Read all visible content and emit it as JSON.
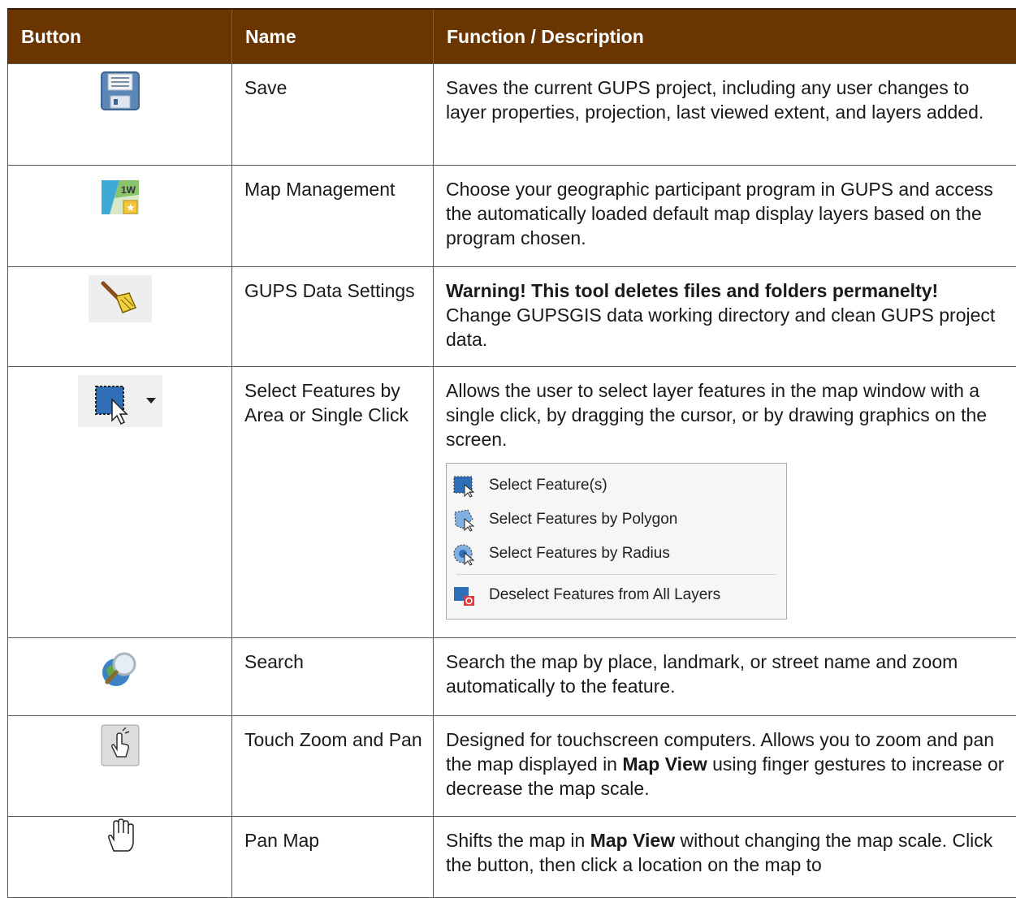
{
  "header": {
    "col_button": "Button",
    "col_name": "Name",
    "col_function": "Function / Description"
  },
  "rows": [
    {
      "icon": "save-floppy-icon",
      "name": "Save",
      "desc": "Saves the current GUPS project, including any user changes to layer properties, projection, last viewed extent, and layers added."
    },
    {
      "icon": "map-management-icon",
      "name": "Map Management",
      "desc": "Choose your geographic participant program in GUPS and access the automatically loaded default map display layers based on the program chosen."
    },
    {
      "icon": "broom-settings-icon",
      "name": "GUPS Data Settings",
      "desc_bold": "Warning! This tool deletes files and folders permanelty!",
      "desc": " Change GUPSGIS data working directory and clean GUPS project data."
    },
    {
      "icon": "select-features-icon",
      "name": "Select Features by Area or Single Click",
      "desc": "Allows the user to select layer features in the map window with a single click, by dragging the cursor, or by drawing graphics on the screen.",
      "menu": {
        "items": [
          "Select Feature(s)",
          "Select Features by Polygon",
          "Select Features by Radius"
        ],
        "footer_item": "Deselect Features from All Layers"
      }
    },
    {
      "icon": "search-globe-icon",
      "name": "Search",
      "desc": "Search the map by place, landmark, or street name and zoom automatically to the feature."
    },
    {
      "icon": "touch-zoom-icon",
      "name": "Touch Zoom and Pan",
      "desc_pre": "Designed for touchscreen computers. Allows you to zoom and pan the map displayed in ",
      "desc_bold": "Map View",
      "desc_post": " using finger gestures to increase or decrease the map scale."
    },
    {
      "icon": "hand-pan-icon",
      "name": "Pan Map",
      "desc_pre": "Shifts the map in ",
      "desc_bold": "Map View",
      "desc_post": " without changing the map scale. Click the button, then click a location on the map to"
    }
  ],
  "colors": {
    "header_bg": "#6b3500",
    "header_text": "#ffffff",
    "border": "#555555"
  }
}
